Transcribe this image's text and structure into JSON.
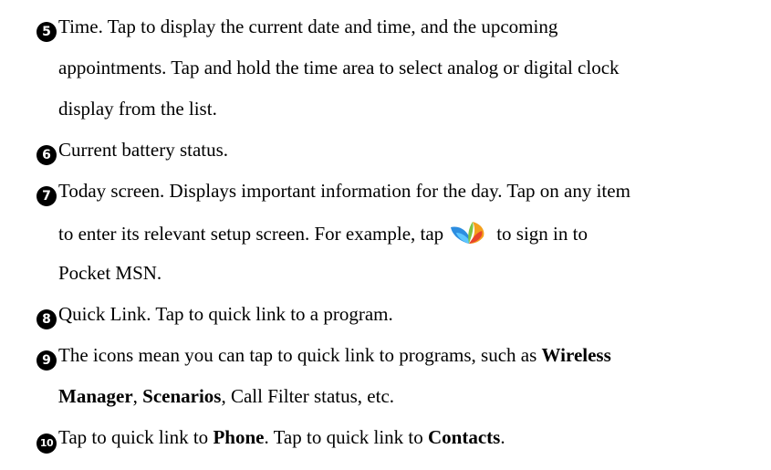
{
  "items": [
    {
      "num": "5",
      "lines": [
        "Time. Tap to display the current date and time, and the upcoming",
        "appointments. Tap and hold the time area to select analog or digital clock",
        "display from the list."
      ]
    },
    {
      "num": "6",
      "lines": [
        "Current battery status."
      ]
    },
    {
      "num": "7",
      "line1": "Today screen. Displays important information for the day. Tap on any item",
      "line2a": "to enter its relevant setup screen. For example, tap",
      "line2b": "to sign in to",
      "line3": "Pocket MSN."
    },
    {
      "num": "8",
      "lines": [
        "Quick Link. Tap to quick link to a program."
      ]
    },
    {
      "num": "9",
      "line1a": "The icons mean you can tap to quick link to programs, such as ",
      "line1b": "Wireless",
      "line2a": "Manager",
      "line2b": ", ",
      "line2c": "Scenarios",
      "line2d": ", Call Filter status, etc."
    },
    {
      "num": "10",
      "a": "Tap to quick link to ",
      "b": "Phone",
      "c": ". Tap to quick link to ",
      "d": "Contacts",
      "e": "."
    }
  ],
  "icons": {
    "msn": "msn-butterfly-icon"
  }
}
